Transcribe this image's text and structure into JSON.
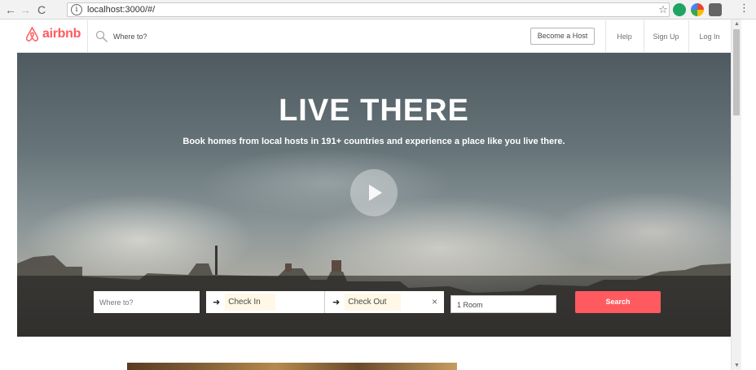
{
  "browser": {
    "url": "localhost:3000/#/",
    "icons": [
      "back-icon",
      "forward-icon",
      "reload-icon",
      "info-icon",
      "star-icon",
      "menu-icon"
    ]
  },
  "header": {
    "logo_text": "airbnb",
    "search_placeholder": "Where to?",
    "become_host": "Become a Host",
    "help": "Help",
    "sign_up": "Sign Up",
    "log_in": "Log In",
    "brand_color": "#ff5a5f"
  },
  "hero": {
    "title": "LIVE THERE",
    "subtitle": "Book homes from local hosts in 191+ countries and experience a place like you live there."
  },
  "search_form": {
    "where_placeholder": "Where to?",
    "check_in": "Check In",
    "check_out": "Check Out",
    "clear": "×",
    "rooms": "1 Room",
    "search_button": "Search"
  }
}
